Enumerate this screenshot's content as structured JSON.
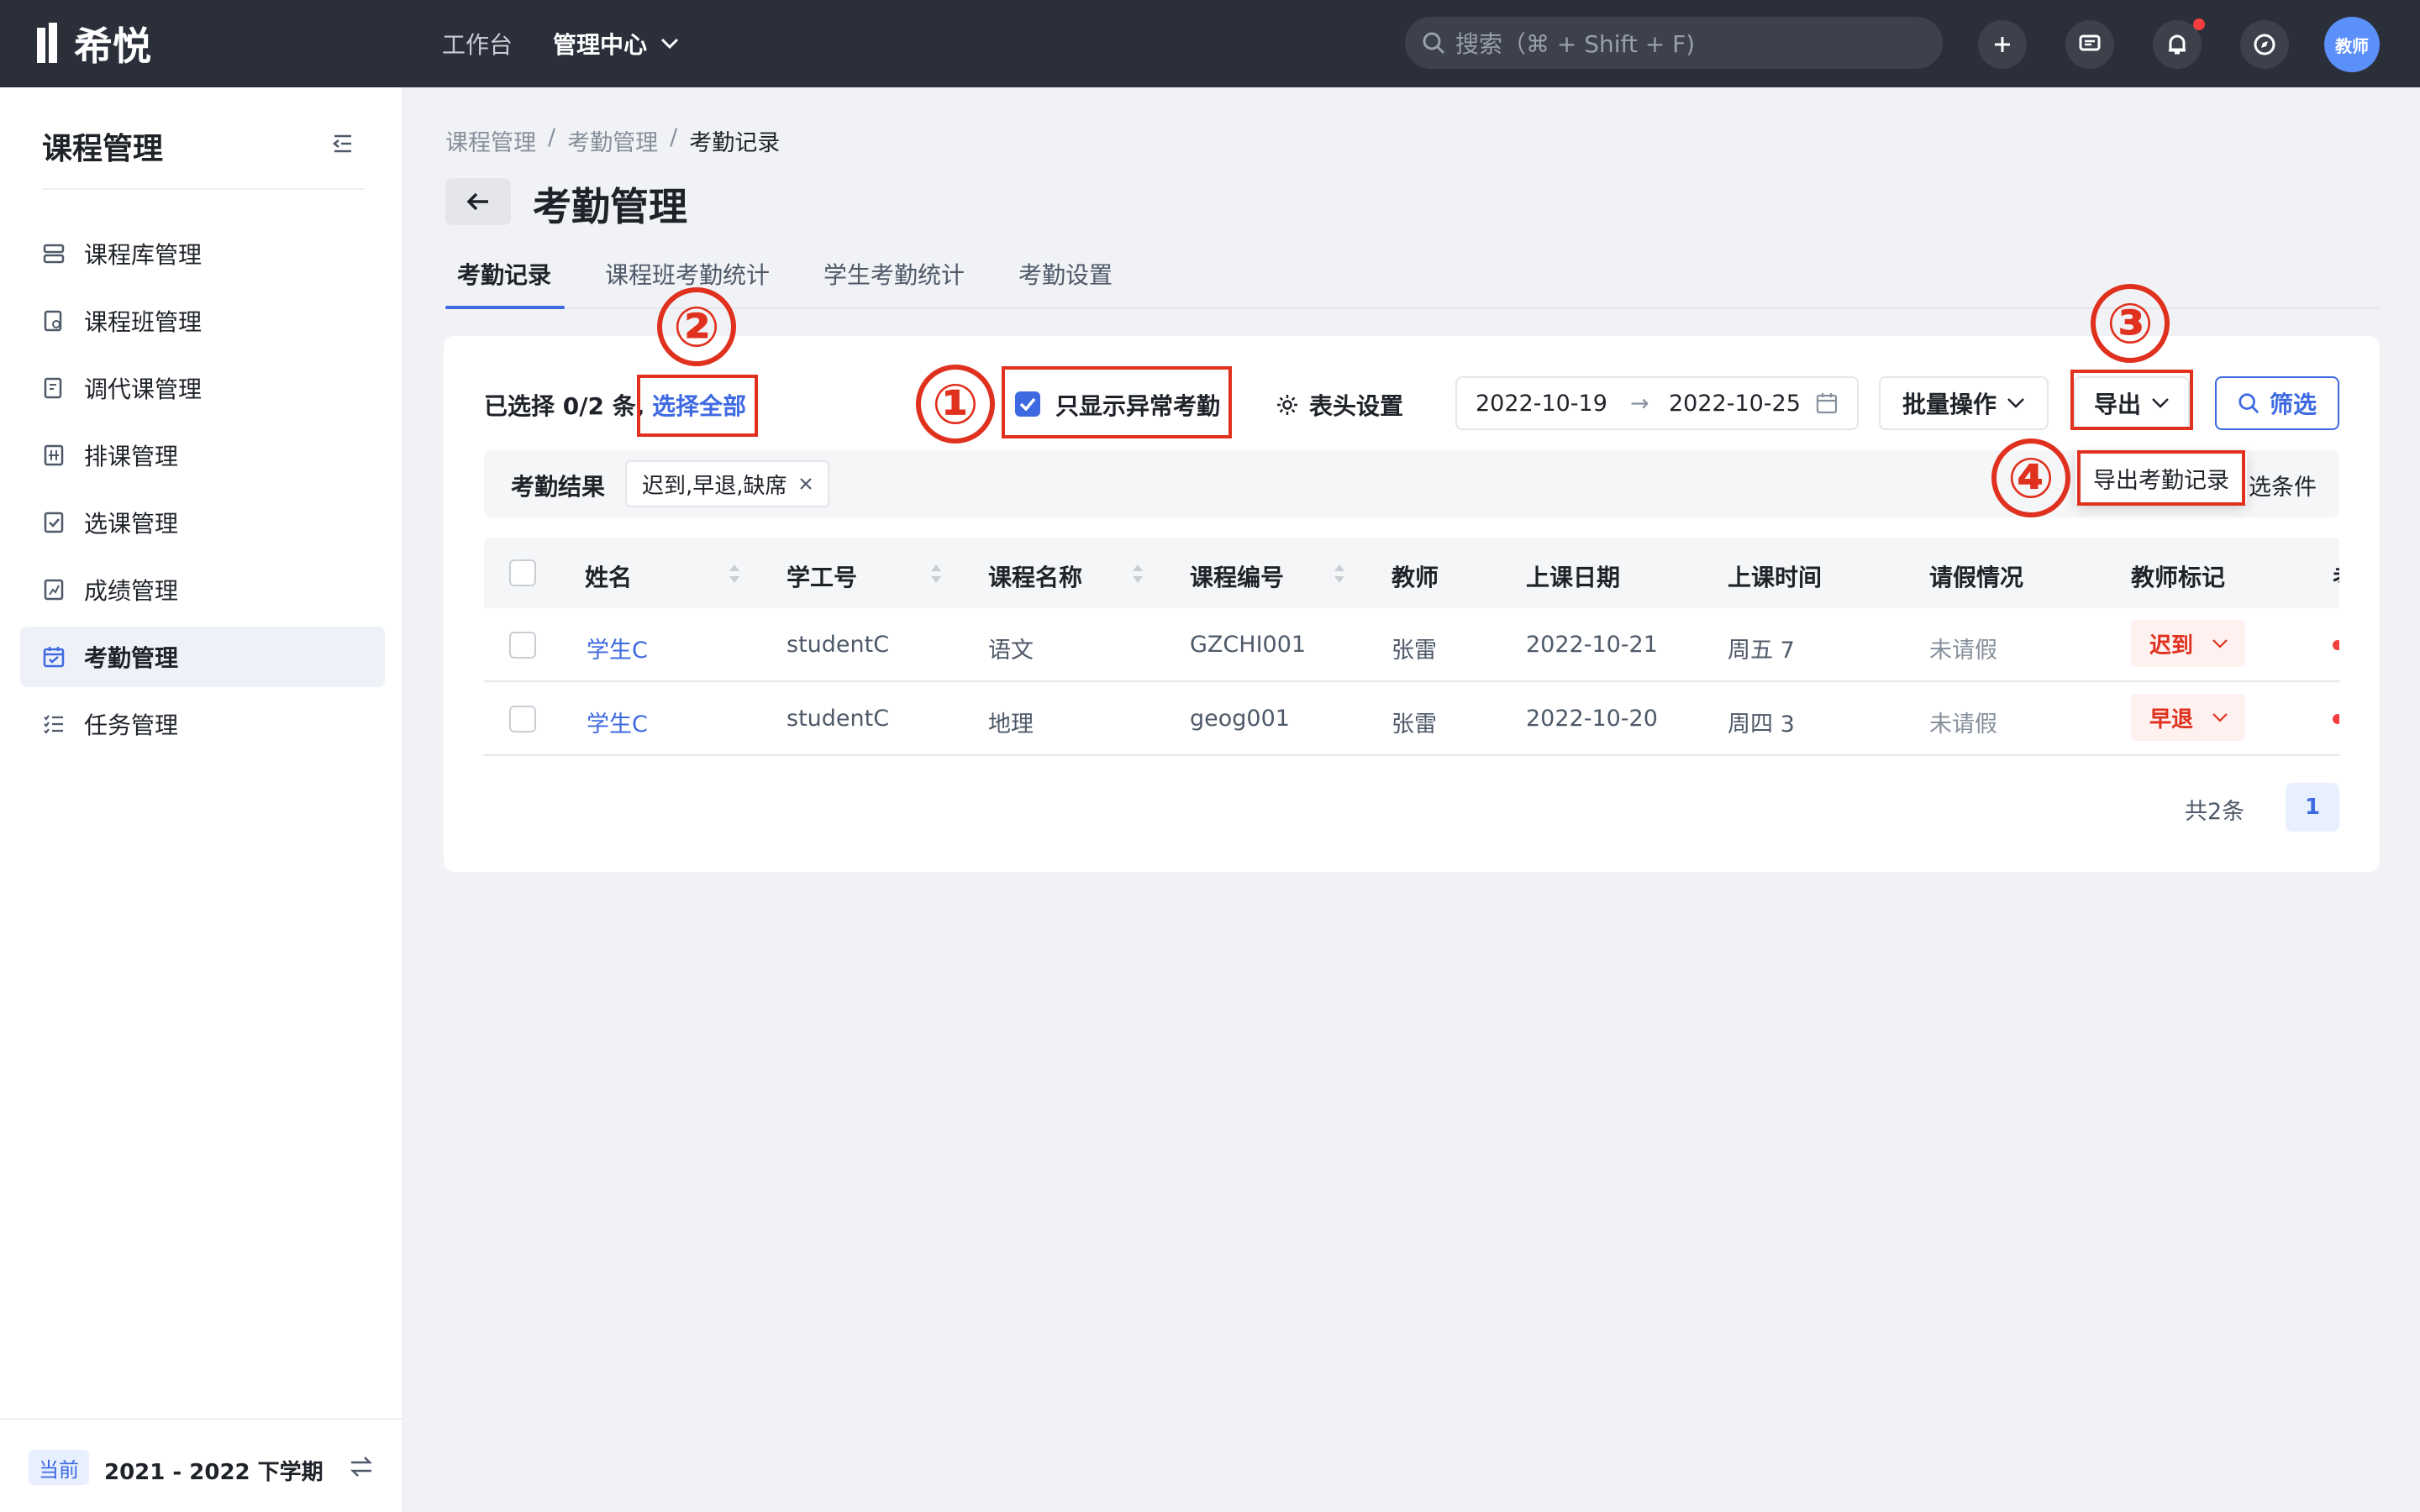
{
  "app": {
    "logo_text": "希悦"
  },
  "topnav": {
    "workbench": "工作台",
    "admin_center": "管理中心"
  },
  "search": {
    "placeholder": "搜索（⌘ + Shift + F)"
  },
  "user": {
    "avatar_label": "教师"
  },
  "sidebar": {
    "title": "课程管理",
    "items": [
      {
        "label": "课程库管理",
        "icon": "course-library-icon"
      },
      {
        "label": "课程班管理",
        "icon": "class-icon"
      },
      {
        "label": "调代课管理",
        "icon": "substitute-icon"
      },
      {
        "label": "排课管理",
        "icon": "schedule-icon"
      },
      {
        "label": "选课管理",
        "icon": "selection-icon"
      },
      {
        "label": "成绩管理",
        "icon": "grade-icon"
      },
      {
        "label": "考勤管理",
        "icon": "calendar-icon",
        "active": true
      },
      {
        "label": "任务管理",
        "icon": "task-list-icon"
      }
    ],
    "term_badge": "当前",
    "term": "2021 - 2022 下学期"
  },
  "breadcrumb": [
    "课程管理",
    "/",
    "考勤管理",
    "/",
    "考勤记录"
  ],
  "page": {
    "title": "考勤管理"
  },
  "tabs": [
    "考勤记录",
    "课程班考勤统计",
    "学生考勤统计",
    "考勤设置"
  ],
  "toolbar": {
    "selected_info": "已选择 0/2 条,",
    "select_all": "选择全部",
    "only_abnormal": "只显示异常考勤",
    "column_settings": "表头设置",
    "date_start": "2022-10-19",
    "date_sep": "→",
    "date_end": "2022-10-25",
    "batch": "批量操作",
    "export": "导出",
    "filter": "筛选"
  },
  "filter": {
    "label": "考勤结果",
    "tag": "迟到,早退,缺席",
    "clear": "选条件"
  },
  "export_menu": {
    "item": "导出考勤记录"
  },
  "table": {
    "columns": [
      "姓名",
      "学工号",
      "课程名称",
      "课程编号",
      "教师",
      "上课日期",
      "上课时间",
      "请假情况",
      "教师标记"
    ],
    "rows": [
      {
        "name": "学生C",
        "id": "studentC",
        "course": "语文",
        "code": "GZCHI001",
        "teacher": "张雷",
        "date": "2022-10-21",
        "time": "周五 7",
        "leave": "未请假",
        "mark": "迟到"
      },
      {
        "name": "学生C",
        "id": "studentC",
        "course": "地理",
        "code": "geog001",
        "teacher": "张雷",
        "date": "2022-10-20",
        "time": "周四 3",
        "leave": "未请假",
        "mark": "早退"
      }
    ]
  },
  "pagination": {
    "total": "共2条",
    "page": "1"
  },
  "annotations": [
    "①",
    "②",
    "③",
    "④"
  ],
  "colors": {
    "accent": "#3e6ae1",
    "annotation": "#e0301e",
    "topbar": "#2b2f3a"
  }
}
